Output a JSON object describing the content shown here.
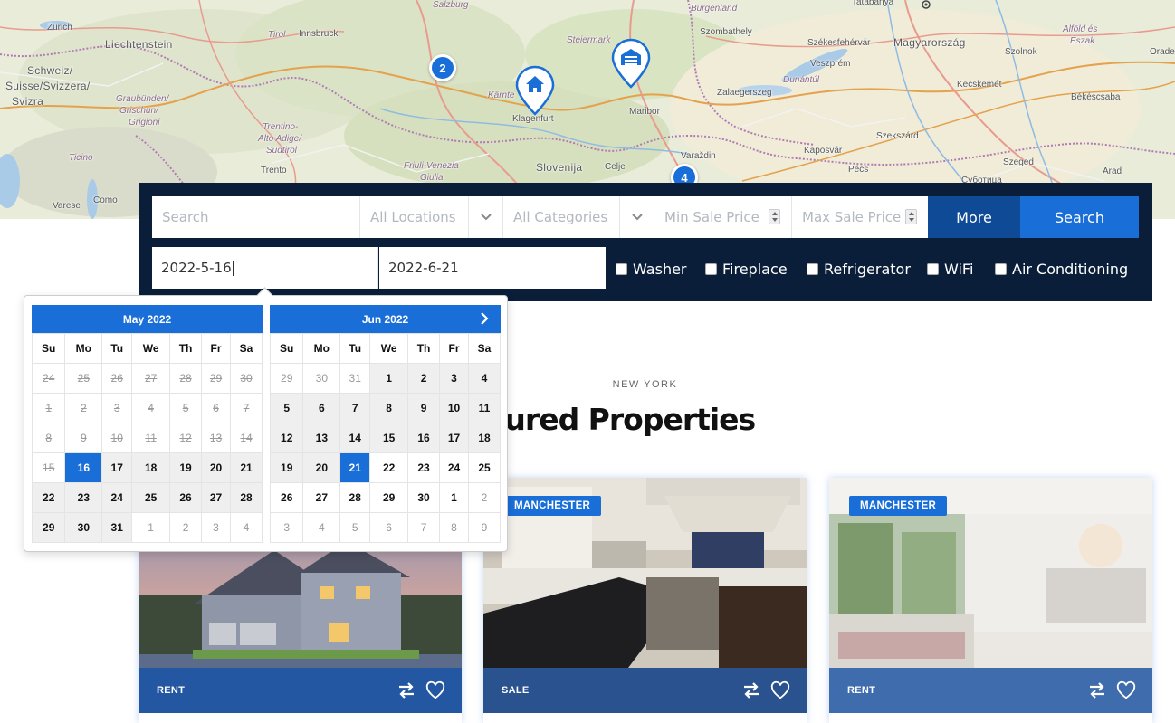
{
  "map": {
    "labels": {
      "salzburg": "Salzburg",
      "burgenland": "Burgenland",
      "tatabanya": "Tatabánya",
      "zurich": "Zürich",
      "liechtenstein": "Liechtenstein",
      "tirol": "Tirol",
      "innsbruck": "Innsbruck",
      "steiermark": "Steiermark",
      "szombathely": "Szombathely",
      "szekesfehervar": "Székesfehérvár",
      "magyarorszag": "Magyarország",
      "alfold": "Alföld és",
      "eszak": "Észak",
      "szolnok": "Szolnok",
      "orade": "Orade",
      "schweiz1": "Schweiz/",
      "schweiz2": "Suisse/Svizzera/",
      "schweiz3": "Svizra",
      "veszprem": "Veszprém",
      "kecskemet": "Kecskemét",
      "karnten": "Kärnte",
      "klagenfurt": "Klagenfurt",
      "maribor": "Maribor",
      "zalaegerszeg": "Zalaegerszeg",
      "dunantul": "Dunántúl",
      "bekescsaba": "Békéscsaba",
      "graubunden1": "Graubünden/",
      "graubunden2": "Grischun/",
      "graubunden3": "Grigioni",
      "trentino1": "Trentino-",
      "trentino2": "Alto Adige/",
      "trentino3": "Südtirol",
      "szekszard": "Szekszárd",
      "ticino": "Ticino",
      "slovenija": "Slovenija",
      "celje": "Celje",
      "varazdin": "Varaždin",
      "kaposvar": "Kaposvár",
      "friuli1": "Friuli-Venezia",
      "friuli2": "Giulia",
      "trento": "Trento",
      "pecs": "Pécs",
      "szeged": "Szeged",
      "arad": "Arad",
      "subotica": "Суботица",
      "como": "Como",
      "varese": "Varese"
    },
    "clusters": {
      "c1": "2",
      "c2": "4"
    }
  },
  "search": {
    "keyword_placeholder": "Search",
    "location_label": "All Locations",
    "category_label": "All Categories",
    "min_price_placeholder": "Min Sale Price",
    "max_price_placeholder": "Max Sale Price",
    "more_label": "More",
    "search_label": "Search",
    "checkin": "2022-5-16",
    "checkout": "2022-6-21",
    "amenities": [
      "Washer",
      "Fireplace",
      "Refrigerator",
      "WiFi",
      "Air Conditioning"
    ]
  },
  "section": {
    "kicker": "NEW YORK",
    "heading": "eatured Properties"
  },
  "cards": [
    {
      "tag": "",
      "status": "RENT"
    },
    {
      "tag": "MANCHESTER",
      "status": "SALE"
    },
    {
      "tag": "MANCHESTER",
      "status": "RENT"
    }
  ],
  "datepicker": {
    "weekdays": [
      "Su",
      "Mo",
      "Tu",
      "We",
      "Th",
      "Fr",
      "Sa"
    ],
    "months": [
      {
        "title": "May 2022",
        "rows": [
          [
            "24",
            "25",
            "26",
            "27",
            "28",
            "29",
            "30"
          ],
          [
            "1",
            "2",
            "3",
            "4",
            "5",
            "6",
            "7"
          ],
          [
            "8",
            "9",
            "10",
            "11",
            "12",
            "13",
            "14"
          ],
          [
            "15",
            "16",
            "17",
            "18",
            "19",
            "20",
            "21"
          ],
          [
            "22",
            "23",
            "24",
            "25",
            "26",
            "27",
            "28"
          ],
          [
            "29",
            "30",
            "31",
            "1",
            "2",
            "3",
            "4"
          ]
        ]
      },
      {
        "title": "Jun 2022",
        "rows": [
          [
            "29",
            "30",
            "31",
            "1",
            "2",
            "3",
            "4"
          ],
          [
            "5",
            "6",
            "7",
            "8",
            "9",
            "10",
            "11"
          ],
          [
            "12",
            "13",
            "14",
            "15",
            "16",
            "17",
            "18"
          ],
          [
            "19",
            "20",
            "21",
            "22",
            "23",
            "24",
            "25"
          ],
          [
            "26",
            "27",
            "28",
            "29",
            "30",
            "1",
            "2"
          ],
          [
            "3",
            "4",
            "5",
            "6",
            "7",
            "8",
            "9"
          ]
        ]
      }
    ]
  },
  "colors": {
    "brand_blue": "#1a6ed8",
    "navy": "#0b1e39",
    "more_button": "#0f4a96"
  }
}
